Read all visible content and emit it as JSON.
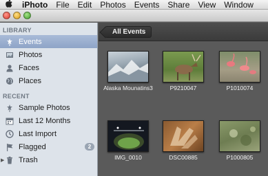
{
  "menubar": {
    "apple_glyph": "",
    "items": [
      "iPhoto",
      "File",
      "Edit",
      "Photos",
      "Events",
      "Share",
      "View",
      "Window"
    ]
  },
  "sidebar": {
    "library_heading": "LIBRARY",
    "library_items": [
      {
        "label": "Events",
        "icon": "events-icon",
        "selected": true
      },
      {
        "label": "Photos",
        "icon": "photos-icon"
      },
      {
        "label": "Faces",
        "icon": "faces-icon"
      },
      {
        "label": "Places",
        "icon": "places-icon"
      }
    ],
    "recent_heading": "RECENT",
    "recent_items": [
      {
        "label": "Sample Photos",
        "icon": "events-icon"
      },
      {
        "label": "Last 12 Months",
        "icon": "calendar-icon"
      },
      {
        "label": "Last Import",
        "icon": "import-icon"
      },
      {
        "label": "Flagged",
        "icon": "flag-icon",
        "badge": "2"
      },
      {
        "label": "Trash",
        "icon": "trash-icon"
      }
    ]
  },
  "main": {
    "breadcrumb": "All Events",
    "events": [
      {
        "name": "Alaska Mounatins3"
      },
      {
        "name": "P9210047"
      },
      {
        "name": "P1010074"
      },
      {
        "name": "IMG_0010"
      },
      {
        "name": "DSC00885"
      },
      {
        "name": "P1000805"
      }
    ]
  },
  "colors": {
    "sidebar_bg": "#dde3ea",
    "selection": "#8ea4c7",
    "main_bg": "#5a5a5a"
  }
}
